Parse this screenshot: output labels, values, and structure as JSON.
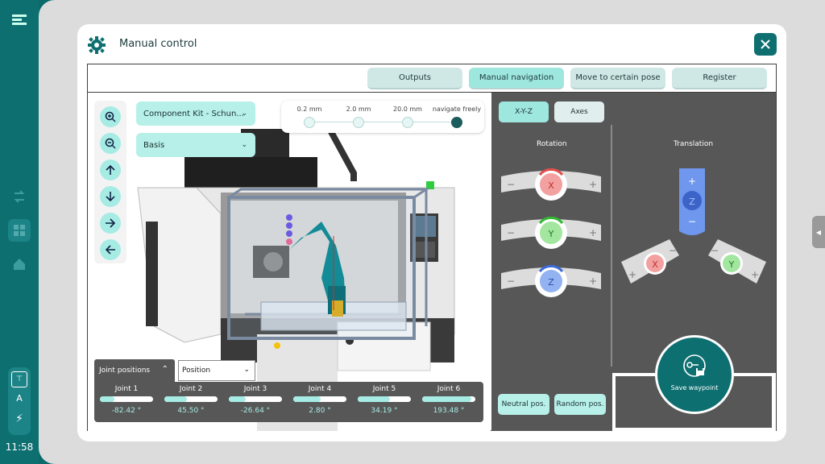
{
  "rail": {
    "icons": [
      "menu-icon",
      "grid-icon",
      "exchange-icon",
      "home-icon",
      "frame-icon",
      "font-icon",
      "power-icon"
    ],
    "font_label": "A",
    "time": "11:58"
  },
  "dialog": {
    "title": "Manual control"
  },
  "tabs": [
    {
      "label": "Outputs",
      "active": false
    },
    {
      "label": "Manual navigation",
      "active": true
    },
    {
      "label": "Move to certain pose",
      "active": false
    },
    {
      "label": "Register",
      "active": false
    }
  ],
  "scene": {
    "component_select": "Component Kit - Schun...",
    "frame_select": "Basis",
    "steps": [
      "0.2 mm",
      "2.0 mm",
      "20.0 mm",
      "navigate freely"
    ],
    "selected_step": "navigate freely"
  },
  "joints": {
    "header": "Joint positions",
    "mode_select": "Position",
    "items": [
      {
        "name": "Joint 1",
        "value": "-82.42 °",
        "level": 0.27
      },
      {
        "name": "Joint 2",
        "value": "45.50 °",
        "level": 0.42
      },
      {
        "name": "Joint 3",
        "value": "-26.64 °",
        "level": 0.32
      },
      {
        "name": "Joint 4",
        "value": "2.80 °",
        "level": 0.51
      },
      {
        "name": "Joint 5",
        "value": "34.19 °",
        "level": 0.6
      },
      {
        "name": "Joint 6",
        "value": "193.48 °",
        "level": 0.92
      }
    ]
  },
  "controls": {
    "modes": [
      {
        "label": "X-Y-Z",
        "active": true
      },
      {
        "label": "Axes",
        "active": false
      }
    ],
    "rotation_label": "Rotation",
    "translation_label": "Translation",
    "rotation_axes": [
      {
        "axis": "X",
        "color": "#f2a0a0"
      },
      {
        "axis": "Y",
        "color": "#a3e6a0"
      },
      {
        "axis": "Z",
        "color": "#92b2f2"
      }
    ],
    "translation_axes": [
      {
        "axis": "Z",
        "color": "#4e7be2"
      },
      {
        "axis": "X",
        "color": "#f2a0a0"
      },
      {
        "axis": "Y",
        "color": "#a3e6a0"
      }
    ],
    "minus": "−",
    "plus": "+",
    "neutral_button": "Neutral pos.",
    "random_button": "Random pos.",
    "save_waypoint": "Save waypoint"
  }
}
